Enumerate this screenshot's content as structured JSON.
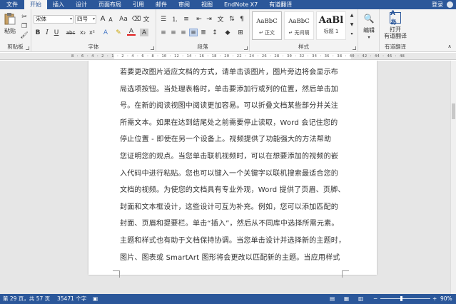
{
  "tabs": {
    "file": "文件",
    "items": [
      "开始",
      "插入",
      "设计",
      "页面布局",
      "引用",
      "邮件",
      "审阅",
      "视图",
      "EndNote X7",
      "有道翻译"
    ],
    "active_index": 0,
    "login": "登录"
  },
  "ribbon": {
    "clipboard": {
      "paste": "粘贴",
      "label": "剪贴板"
    },
    "font": {
      "name": "宋体",
      "size": "四号",
      "grow": "A",
      "shrink": "A",
      "case": "Aa",
      "bold": "B",
      "italic": "I",
      "underline": "U",
      "strike": "abc",
      "sub": "x₂",
      "sup": "x²",
      "color_a": "A",
      "label": "字体"
    },
    "paragraph": {
      "label": "段落"
    },
    "styles": {
      "items": [
        {
          "sample": "AaBbC",
          "name": "↵ 正文"
        },
        {
          "sample": "AaBbC",
          "name": "↵ 无间隔"
        },
        {
          "sample": "AaBl",
          "name": "标题 1"
        }
      ],
      "label": "样式"
    },
    "editing": {
      "label": "编辑"
    },
    "translate": {
      "line1": "打开",
      "line2": "有道翻译",
      "label": "有道翻译"
    }
  },
  "ruler": {
    "ticks": "8 · 6 · 4 · 2 · 1 · 2 · 4 · 6 · 8 · 10 · 12 · 14 · 16 · 18 · 20 · 22 · 24 · 26 · 28 · 30 · 32 · 34 · 36 · 38 · 40 · 42 · 44 · 46 · 48"
  },
  "document": {
    "lines": [
      "若要更改图片适应文档的方式，请单击该图片，图片旁边将会显示布",
      "局选项按钮。当处理表格时，单击要添加行或列的位置，然后单击加",
      "号。在新的阅读视图中阅读更加容易。可以折叠文档某些部分并关注",
      "所需文本。如果在达到结尾处之前需要停止读取，Word 会记住您的",
      "停止位置 - 即使在另一个设备上。视频提供了功能强大的方法帮助",
      "您证明您的观点。当您单击联机视频时，可以在想要添加的视频的嵌",
      "入代码中进行粘贴。您也可以键入一个关键字以联机搜索最适合您的",
      "文档的视频。为使您的文档具有专业外观，Word 提供了页眉、页脚、",
      "封面和文本框设计，这些设计可互为补充。例如，您可以添加匹配的",
      "封面、页眉和提要栏。单击“插入”，然后从不同库中选择所需元素。",
      "主题和样式也有助于文档保持协调。当您单击设计并选择新的主题时，",
      "图片、图表或 SmartArt 图形将会更改以匹配新的主题。当应用样式"
    ]
  },
  "status": {
    "page": "第 29 页，共 57 页",
    "words": "35471 个字",
    "zoom": "90%",
    "minus": "−",
    "plus": "+"
  },
  "colors": {
    "accent": "#2b579a",
    "ribbon_bg": "#f3f3f3",
    "doc_bg": "#e6e6e6"
  }
}
